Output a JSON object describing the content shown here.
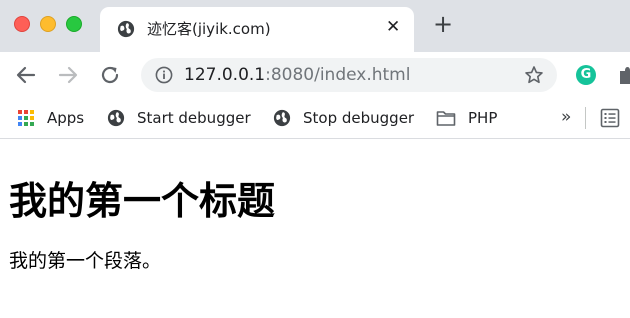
{
  "browser": {
    "tab": {
      "title": "迹忆客(jiyik.com)",
      "close_glyph": "✕",
      "favicon": "globe-icon"
    },
    "new_tab_glyph": "+",
    "address_bar": {
      "url_host": "127.0.0.1",
      "url_rest": ":8080/index.html"
    },
    "bookmarks": [
      {
        "label": "Apps",
        "icon": "apps-grid-icon"
      },
      {
        "label": "Start debugger",
        "icon": "globe-icon"
      },
      {
        "label": "Stop debugger",
        "icon": "globe-icon"
      },
      {
        "label": "PHP",
        "icon": "folder-icon"
      }
    ],
    "overflow_glyph": "»",
    "colors": {
      "tabstrip": "#dee1e6",
      "omnibox": "#f1f3f4",
      "grammarly": "#15c39a"
    }
  },
  "page": {
    "heading": "我的第一个标题",
    "paragraph": "我的第一个段落。"
  }
}
